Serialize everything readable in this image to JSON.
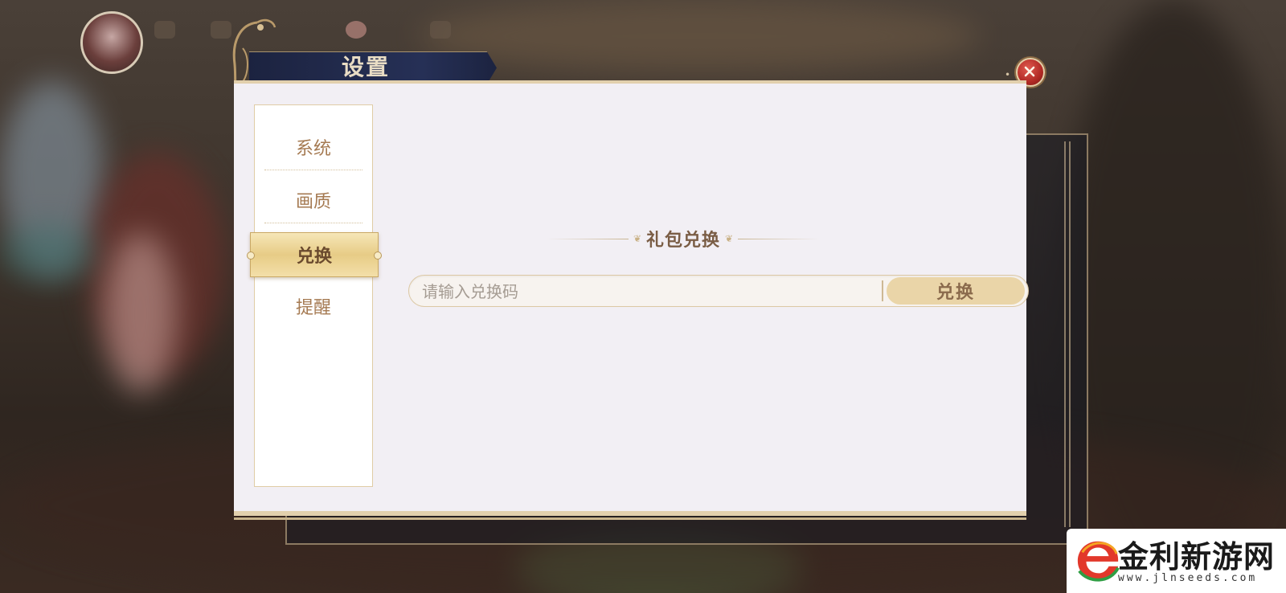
{
  "window": {
    "title": "设置"
  },
  "close_button": {
    "icon": "close-icon"
  },
  "menu": {
    "items": [
      {
        "label": "系统",
        "active": false
      },
      {
        "label": "画质",
        "active": false
      },
      {
        "label": "兑换",
        "active": true
      },
      {
        "label": "提醒",
        "active": false
      }
    ]
  },
  "redeem": {
    "section_title": "礼包兑换",
    "input_placeholder": "请输入兑换码",
    "input_value": "",
    "button_label": "兑换"
  },
  "watermark": {
    "name": "金利新游网",
    "url": "www.jlnseeds.com"
  },
  "colors": {
    "panel_bg": "#f2eff4",
    "accent_gold": "#ead5a8",
    "title_ribbon": "#263056",
    "close_red": "#b12a25",
    "menu_text": "#a57a52"
  }
}
